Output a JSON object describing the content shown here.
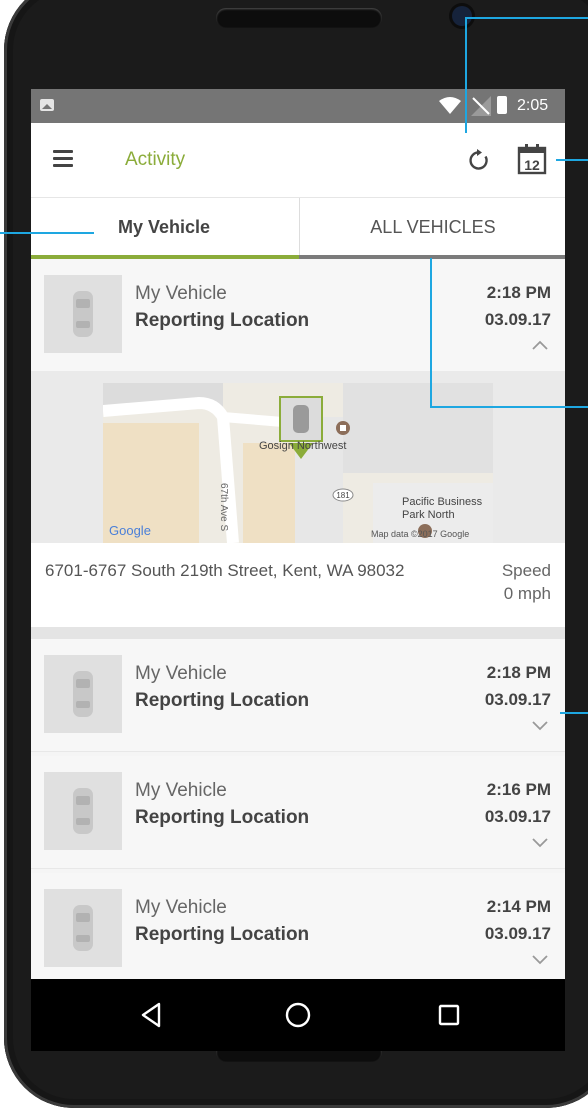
{
  "status_bar": {
    "time": "2:05"
  },
  "app_bar": {
    "title": "Activity",
    "icons": [
      "menu-icon",
      "refresh-icon",
      "calendar-icon"
    ],
    "calendar_day": "12"
  },
  "tabs": [
    {
      "label": "My Vehicle",
      "active": true
    },
    {
      "label": "ALL VEHICLES",
      "active": false
    }
  ],
  "activities": [
    {
      "vehicle": "My Vehicle",
      "event": "Reporting Location",
      "time": "2:18 PM",
      "date": "03.09.17",
      "expanded": true
    },
    {
      "vehicle": "My Vehicle",
      "event": "Reporting Location",
      "time": "2:18 PM",
      "date": "03.09.17",
      "expanded": false
    },
    {
      "vehicle": "My Vehicle",
      "event": "Reporting Location",
      "time": "2:16 PM",
      "date": "03.09.17",
      "expanded": false
    },
    {
      "vehicle": "My Vehicle",
      "event": "Reporting Location",
      "time": "2:14 PM",
      "date": "03.09.17",
      "expanded": false
    }
  ],
  "detail": {
    "address": "6701-6767 South 219th Street, Kent, WA 98032",
    "speed_label": "Speed",
    "speed_value": "0 mph",
    "map": {
      "place_1": "Gosign Northwest",
      "place_2": "Pacific Business",
      "place_3": "Park North",
      "street": "67th Ave S",
      "route": "181",
      "logo": "Google",
      "attribution": "Map data ©2017 Google"
    }
  },
  "colors": {
    "accent": "#8bac3a",
    "annotation": "#1ea7e1"
  }
}
